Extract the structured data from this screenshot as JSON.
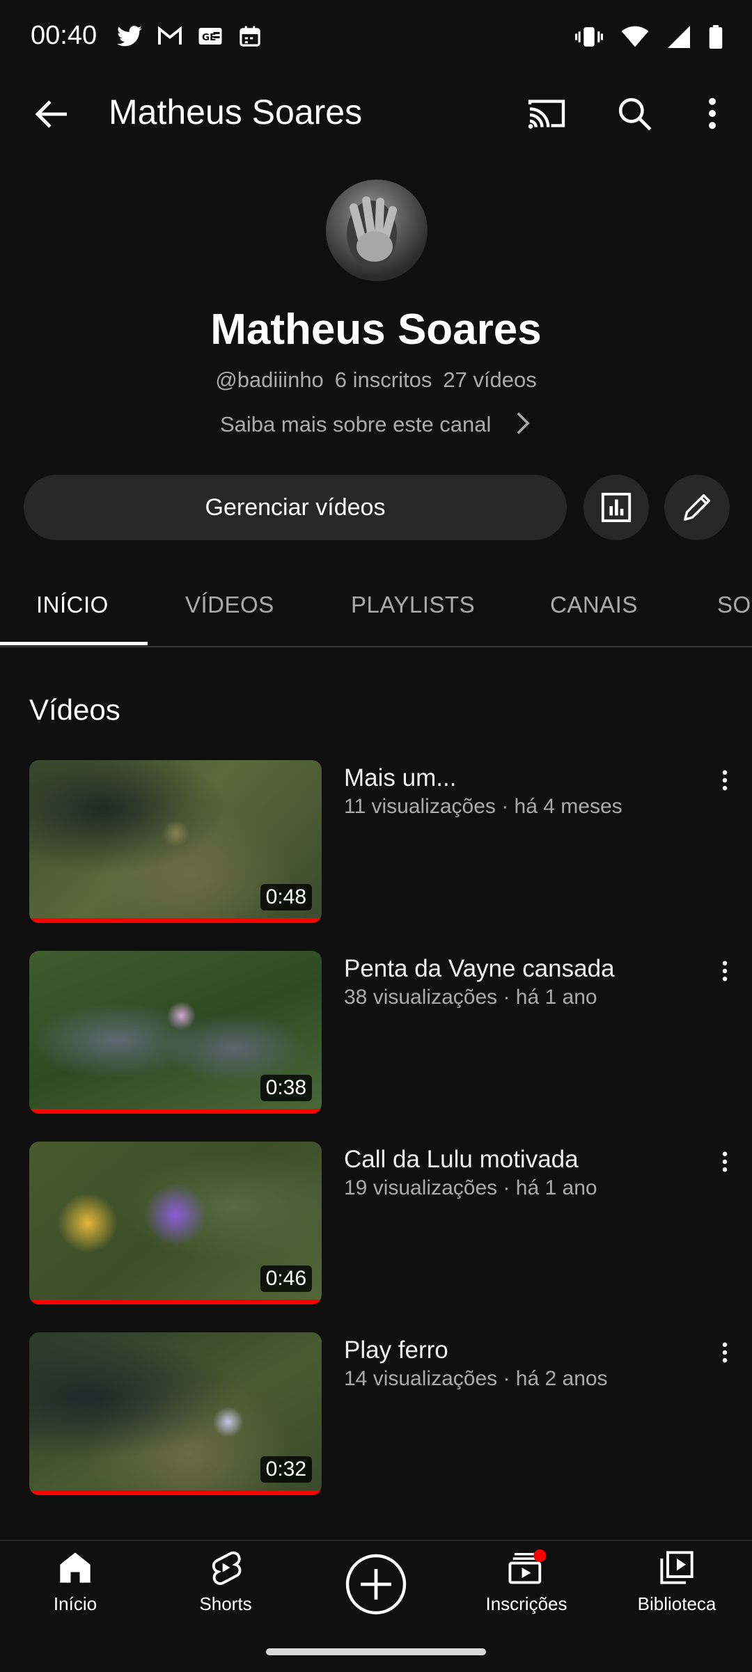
{
  "status_bar": {
    "time": "00:40"
  },
  "top_bar": {
    "title": "Matheus Soares"
  },
  "channel": {
    "name": "Matheus Soares",
    "handle": "@badiiinho",
    "subscribers": "6 inscritos",
    "videos_count": "27 vídeos",
    "about_link": "Saiba mais sobre este canal",
    "manage_label": "Gerenciar vídeos"
  },
  "tabs": [
    {
      "label": "INÍCIO"
    },
    {
      "label": "VÍDEOS"
    },
    {
      "label": "PLAYLISTS"
    },
    {
      "label": "CANAIS"
    },
    {
      "label": "SO"
    }
  ],
  "section": {
    "title": "Vídeos"
  },
  "videos": [
    {
      "title": "Mais um...",
      "meta": "11 visualizações · há 4 meses",
      "duration": "0:48",
      "watched_fraction": 1.0
    },
    {
      "title": "Penta da Vayne cansada",
      "meta": "38 visualizações · há 1 ano",
      "duration": "0:38",
      "watched_fraction": 1.0
    },
    {
      "title": "Call da Lulu motivada",
      "meta": "19 visualizações · há 1 ano",
      "duration": "0:46",
      "watched_fraction": 1.0
    },
    {
      "title": "Play ferro",
      "meta": "14 visualizações · há 2 anos",
      "duration": "0:32",
      "watched_fraction": 1.0
    }
  ],
  "bottom_nav": [
    {
      "label": "Início",
      "icon": "home-icon"
    },
    {
      "label": "Shorts",
      "icon": "shorts-icon"
    },
    {
      "label": "",
      "icon": "create-icon"
    },
    {
      "label": "Inscrições",
      "icon": "subscriptions-icon"
    },
    {
      "label": "Biblioteca",
      "icon": "library-icon"
    }
  ],
  "colors": {
    "background": "#0f0f0f",
    "accent": "#ff0000",
    "surface": "#272727",
    "secondary_text": "#aaaaaa"
  }
}
